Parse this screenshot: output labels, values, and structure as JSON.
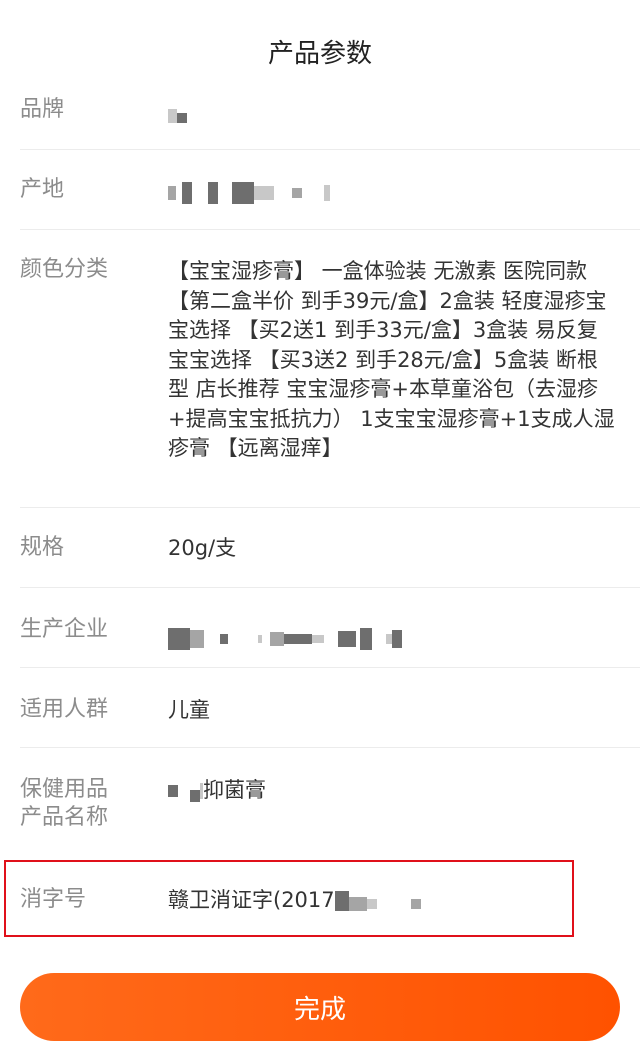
{
  "header": {
    "title": "产品参数"
  },
  "params": {
    "brand": {
      "label": "品牌"
    },
    "origin": {
      "label": "产地"
    },
    "color_category": {
      "label": "颜色分类",
      "value": "【宝宝湿疹膏】 一盒体验装 无激素 医院同款 【第二盒半价 到手39元/盒】2盒装 轻度湿疹宝宝选择 【买2送1 到手33元/盒】3盒装 易反复宝宝选择 【买3送2 到手28元/盒】5盒装 断根型 店长推荐 宝宝湿疹膏+本草童浴包（去湿疹+提高宝宝抵抗力） 1支宝宝湿疹膏+1支成人湿疹膏 【远离湿痒】"
    },
    "spec": {
      "label": "规格",
      "value": "20g/支"
    },
    "manufacturer": {
      "label": "生产企业"
    },
    "target_group": {
      "label": "适用人群",
      "value": "儿童"
    },
    "health_product_name": {
      "label": "保健用品产品名称",
      "value_suffix": "抑菌膏"
    },
    "disinfection_no": {
      "label": "消字号",
      "value_prefix": "赣卫消证字(2017"
    }
  },
  "footer": {
    "done_label": "完成"
  },
  "colors": {
    "accent": "#ff5a00",
    "highlight_border": "#e0101a"
  }
}
